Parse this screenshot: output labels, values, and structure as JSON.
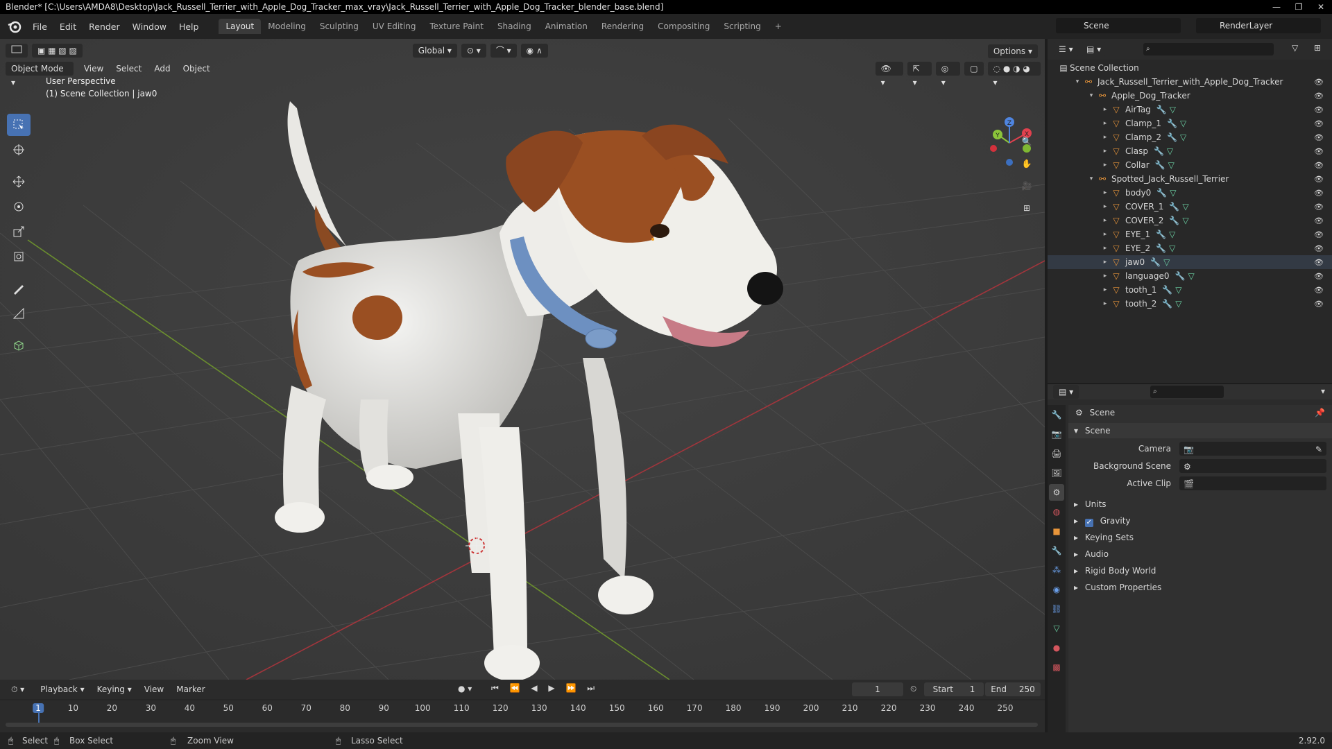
{
  "window": {
    "title": "Blender* [C:\\Users\\AMDA8\\Desktop\\Jack_Russell_Terrier_with_Apple_Dog_Tracker_max_vray\\Jack_Russell_Terrier_with_Apple_Dog_Tracker_blender_base.blend]",
    "controls": [
      "—",
      "❐",
      "✕"
    ]
  },
  "menus": [
    "File",
    "Edit",
    "Render",
    "Window",
    "Help"
  ],
  "workspaces": [
    {
      "label": "Layout",
      "active": true
    },
    {
      "label": "Modeling"
    },
    {
      "label": "Sculpting"
    },
    {
      "label": "UV Editing"
    },
    {
      "label": "Texture Paint"
    },
    {
      "label": "Shading"
    },
    {
      "label": "Animation"
    },
    {
      "label": "Rendering"
    },
    {
      "label": "Compositing"
    },
    {
      "label": "Scripting"
    }
  ],
  "add_workspace": "+",
  "scene_selector": "Scene",
  "view_layer": "RenderLayer",
  "viewport": {
    "transform_orientation": "Global",
    "options": "Options",
    "mode": "Object Mode",
    "header_menus": [
      "View",
      "Select",
      "Add",
      "Object"
    ],
    "perspective": "User Perspective",
    "collection_info": "(1) Scene Collection | jaw0",
    "gizmo_axes": [
      "X",
      "Y",
      "Z"
    ]
  },
  "tools": [
    "select-box-icon",
    "cursor-icon",
    "move-icon",
    "rotate-icon",
    "scale-icon",
    "transform-icon",
    "annotate-icon",
    "measure-icon",
    "add-cube-icon"
  ],
  "timeline": {
    "menus": [
      "Playback",
      "Keying",
      "View",
      "Marker"
    ],
    "current_frame": "1",
    "start_label": "Start",
    "start": "1",
    "end_label": "End",
    "end": "250",
    "ticks": [
      "1",
      "10",
      "20",
      "30",
      "40",
      "50",
      "60",
      "70",
      "80",
      "90",
      "100",
      "110",
      "120",
      "130",
      "140",
      "150",
      "160",
      "170",
      "180",
      "190",
      "200",
      "210",
      "220",
      "230",
      "240",
      "250"
    ]
  },
  "statusbar": {
    "select": "Select",
    "box_select": "Box Select",
    "zoom_view": "Zoom View",
    "lasso_select": "Lasso Select",
    "version": "2.92.0"
  },
  "outliner": {
    "root": "Scene Collection",
    "items": [
      {
        "label": "Jack_Russell_Terrier_with_Apple_Dog_Tracker",
        "depth": 1,
        "type": "empty",
        "expanded": true
      },
      {
        "label": "Apple_Dog_Tracker",
        "depth": 2,
        "type": "empty",
        "expanded": true
      },
      {
        "label": "AirTag",
        "depth": 3,
        "type": "mesh"
      },
      {
        "label": "Clamp_1",
        "depth": 3,
        "type": "mesh"
      },
      {
        "label": "Clamp_2",
        "depth": 3,
        "type": "mesh"
      },
      {
        "label": "Clasp",
        "depth": 3,
        "type": "mesh"
      },
      {
        "label": "Collar",
        "depth": 3,
        "type": "mesh"
      },
      {
        "label": "Spotted_Jack_Russell_Terrier",
        "depth": 2,
        "type": "empty",
        "expanded": true
      },
      {
        "label": "body0",
        "depth": 3,
        "type": "mesh"
      },
      {
        "label": "COVER_1",
        "depth": 3,
        "type": "mesh"
      },
      {
        "label": "COVER_2",
        "depth": 3,
        "type": "mesh"
      },
      {
        "label": "EYE_1",
        "depth": 3,
        "type": "mesh"
      },
      {
        "label": "EYE_2",
        "depth": 3,
        "type": "mesh"
      },
      {
        "label": "jaw0",
        "depth": 3,
        "type": "mesh",
        "selected": true
      },
      {
        "label": "language0",
        "depth": 3,
        "type": "mesh"
      },
      {
        "label": "tooth_1",
        "depth": 3,
        "type": "mesh"
      },
      {
        "label": "tooth_2",
        "depth": 3,
        "type": "mesh"
      }
    ]
  },
  "properties": {
    "context": "Scene",
    "panel_title": "Scene",
    "fields": [
      {
        "label": "Camera"
      },
      {
        "label": "Background Scene"
      },
      {
        "label": "Active Clip"
      }
    ],
    "subpanels": [
      "Units",
      "Gravity",
      "Keying Sets",
      "Audio",
      "Rigid Body World",
      "Custom Properties"
    ],
    "gravity_checked": true
  },
  "colors": {
    "accent": "#4772b3",
    "x_axis": "#e0414e",
    "y_axis": "#8bc43a",
    "z_axis": "#4f85e0",
    "mesh_icon": "#e8953a",
    "modifier_icon": "#6a9ee8",
    "data_icon": "#6cd3a6"
  }
}
